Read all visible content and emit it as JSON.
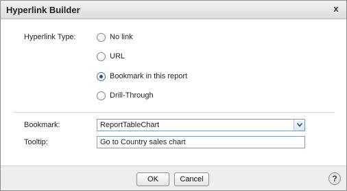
{
  "dialog": {
    "title": "Hyperlink Builder",
    "close_label": "x"
  },
  "hyperlink_type": {
    "label": "Hyperlink Type:",
    "options": [
      {
        "label": "No link",
        "selected": false
      },
      {
        "label": "URL",
        "selected": false
      },
      {
        "label": "Bookmark in this report",
        "selected": true
      },
      {
        "label": "Drill-Through",
        "selected": false
      }
    ]
  },
  "bookmark": {
    "label": "Bookmark:",
    "value": "ReportTableChart"
  },
  "tooltip": {
    "label": "Tooltip:",
    "value": "Go to Country sales chart"
  },
  "footer": {
    "ok_label": "OK",
    "cancel_label": "Cancel",
    "help_label": "?"
  },
  "icons": {
    "close": "close-icon",
    "dropdown": "chevron-down-icon",
    "help": "help-icon"
  }
}
